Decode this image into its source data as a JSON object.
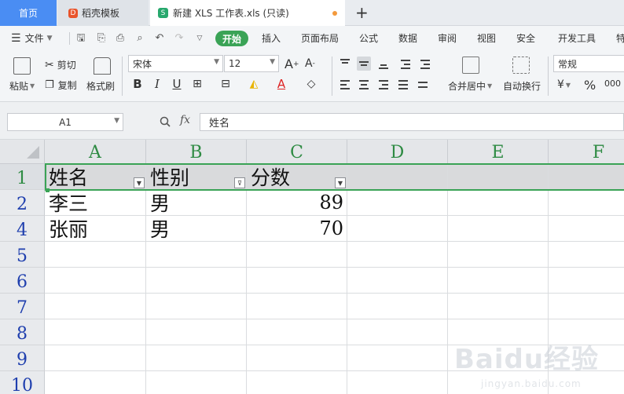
{
  "tabs": {
    "home": "首页",
    "template": "稻壳模板",
    "document": "新建 XLS 工作表.xls (只读)",
    "new_tab": "+"
  },
  "menu": {
    "file": "文件",
    "items": [
      "开始",
      "插入",
      "页面布局",
      "公式",
      "数据",
      "审阅",
      "视图",
      "安全",
      "开发工具",
      "特"
    ]
  },
  "ribbon": {
    "paste": "粘贴",
    "cut": "剪切",
    "copy": "复制",
    "format_painter": "格式刷",
    "font_name": "宋体",
    "font_size": "12",
    "bold": "B",
    "italic": "I",
    "underline": "U",
    "merge_center": "合并居中",
    "wrap_text": "自动换行",
    "number_format": "常规",
    "percent": "%"
  },
  "formula_bar": {
    "cell_ref": "A1",
    "fx": "fx",
    "content": "姓名"
  },
  "sheet": {
    "columns": [
      "A",
      "B",
      "C",
      "D",
      "E",
      "F"
    ],
    "row_numbers": [
      "1",
      "2",
      "4",
      "5",
      "6",
      "7",
      "8",
      "9",
      "10"
    ],
    "header_row": [
      "姓名",
      "性别",
      "分数"
    ],
    "rows": [
      [
        "李三",
        "男",
        "89"
      ],
      [
        "张丽",
        "男",
        "70"
      ]
    ]
  },
  "watermark": {
    "logo": "Baidu经验",
    "url": "jingyan.baidu.com"
  },
  "colors": {
    "accent_green": "#3aa356",
    "tab_blue": "#4a8df3",
    "row_header_blue": "#1f3fae"
  }
}
